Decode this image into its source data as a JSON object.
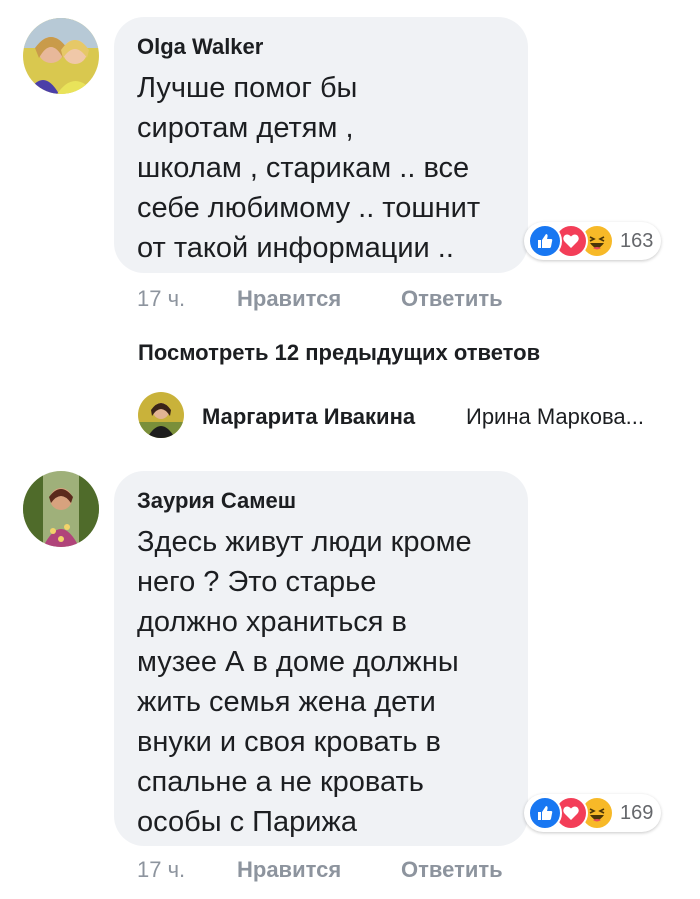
{
  "comments": [
    {
      "author": "Olga Walker",
      "lines": [
        "Лучше  помог бы",
        "сиротам детям ,",
        "школам , старикам .. все",
        "себе любимому .. тошнит",
        "от такой информации .."
      ],
      "reaction_count": "163",
      "reactions": [
        "like-icon",
        "love-icon",
        "haha-icon"
      ],
      "time": "17 ч.",
      "like_label": "Нравится",
      "reply_label": "Ответить"
    },
    {
      "author": "Заурия Самеш",
      "lines": [
        "Здесь живут люди кроме",
        "него ? Это старье",
        "должно храниться в",
        "музее А в доме должны",
        "жить семья жена дети",
        "внуки и своя кровать в",
        "спальне а не кровать",
        "особы с Парижа"
      ],
      "reaction_count": "169",
      "reactions": [
        "like-icon",
        "love-icon",
        "haha-icon"
      ],
      "time": "17 ч.",
      "like_label": "Нравится",
      "reply_label": "Ответить"
    }
  ],
  "view_previous": "Посмотреть 12 предыдущих ответов",
  "collapsed_reply": {
    "author": "Маргарита Ивакина",
    "snippet": "Ирина Маркова..."
  },
  "colors": {
    "bubble": "#f0f2f5",
    "meta": "#8d949e",
    "like": "#1877f2",
    "love": "#f33e58",
    "haha": "#f7b928"
  }
}
